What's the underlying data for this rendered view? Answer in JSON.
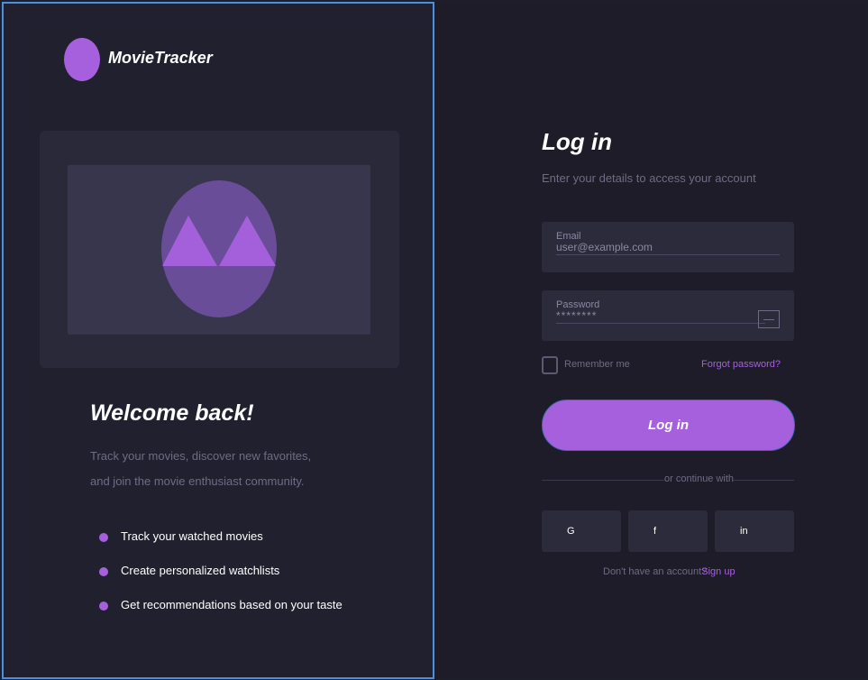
{
  "brand": {
    "name": "MovieTracker",
    "logo_icon": "logo-circle-icon"
  },
  "hero": {
    "image_icon": "mountain-image-placeholder-icon"
  },
  "welcome": {
    "title": "Welcome back!",
    "description_line1": "Track your movies, discover new favorites,",
    "description_line2": "and join the movie enthusiast community."
  },
  "features": [
    {
      "text": "Track your watched movies"
    },
    {
      "text": "Create personalized watchlists"
    },
    {
      "text": "Get recommendations based on your taste"
    }
  ],
  "login": {
    "title": "Log in",
    "subtitle": "Enter your details to access your account",
    "email": {
      "label": "Email",
      "value": "user@example.com"
    },
    "password": {
      "label": "Password",
      "value": "********"
    },
    "remember_label": "Remember me",
    "forgot_label": "Forgot password?",
    "submit_label": "Log in",
    "divider_text": "or continue with",
    "social": [
      {
        "label": "G"
      },
      {
        "label": "f"
      },
      {
        "label": "in"
      }
    ],
    "signup_prompt": "Don't have an account?",
    "signup_link": "Sign up"
  },
  "colors": {
    "accent": "#a660de",
    "left_bg": "#21202f",
    "right_bg": "#1d1c28",
    "field_bg": "#2c2b3c",
    "selection_border": "#4a90e2"
  }
}
